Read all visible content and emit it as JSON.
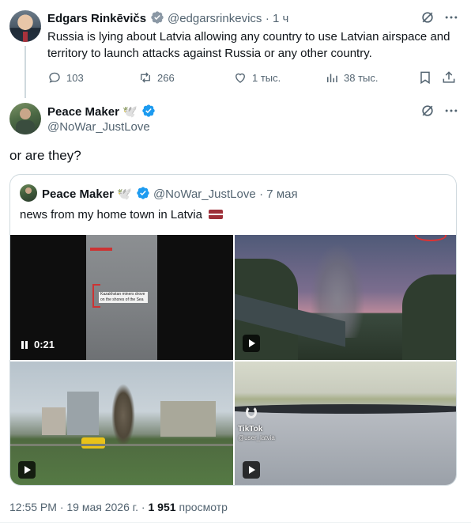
{
  "parent_tweet": {
    "author_name": "Edgars Rinkēvičs",
    "author_handle": "@edgarsrinkevics",
    "time": "· 1 ч",
    "text": "Russia is lying about Latvia allowing any country to use Latvian airspace and territory to launch attacks against Russia or any other country.",
    "replies": "103",
    "retweets": "266",
    "likes": "1 тыс.",
    "views": "38 тыс."
  },
  "main_tweet": {
    "author_name": "Peace Maker",
    "author_emoji": "🕊️",
    "author_handle": "@NoWar_JustLove",
    "text": "or are they?"
  },
  "quoted_tweet": {
    "author_name": "Peace Maker",
    "author_emoji": "🕊️",
    "author_handle": "@NoWar_JustLove",
    "time": "· 7 мая",
    "text": "news from my home town in Latvia",
    "flag": "Latvia flag",
    "media": [
      {
        "type": "video",
        "duration": "0:21",
        "caption": "Kazakhstan miners drove on the shores of the Sea"
      },
      {
        "type": "video"
      },
      {
        "type": "video"
      },
      {
        "type": "video",
        "watermark": "TikTok",
        "watermark_handle": "@user_latvia"
      }
    ]
  },
  "footer": {
    "time": "12:55 PM",
    "date": "· 19 мая 2026 г. ·",
    "views_count": "1 951",
    "views_label": "просмотр"
  },
  "colors": {
    "text": "#0f1419",
    "secondary": "#536471",
    "verified": "#1d9bf0",
    "border": "#cfd9de"
  }
}
